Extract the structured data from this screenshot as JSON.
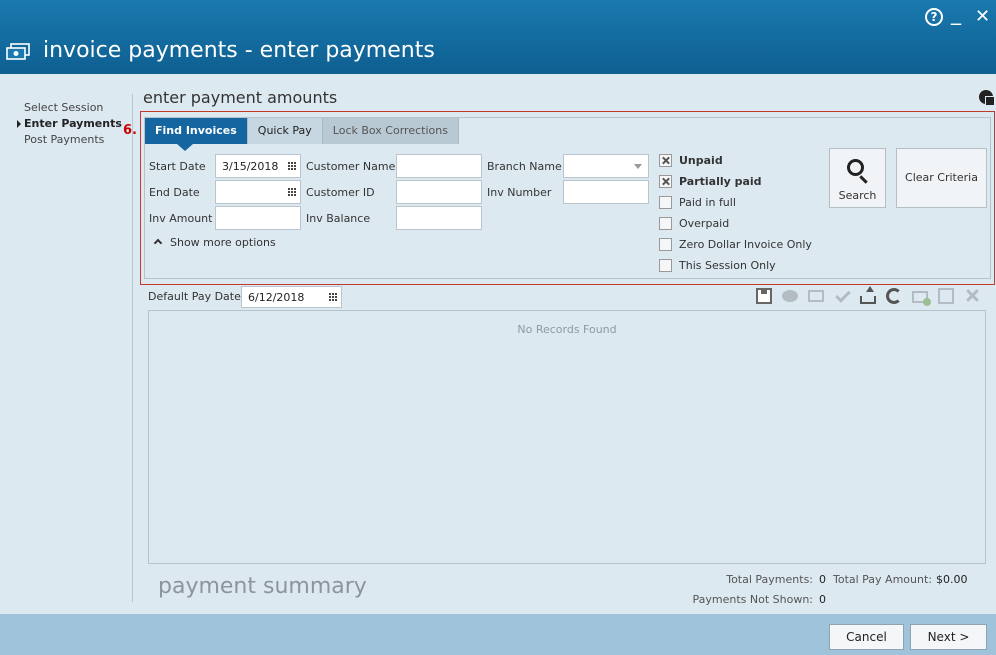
{
  "window": {
    "title": "invoice payments - enter payments",
    "help_label": "?",
    "minimize_label": "_",
    "close_label": "✕"
  },
  "steps": [
    {
      "label": "Select Session"
    },
    {
      "label": "Enter Payments",
      "active": true
    },
    {
      "label": "Post Payments"
    }
  ],
  "section_title": "enter payment amounts",
  "step_marker": "6.",
  "tabs": [
    {
      "label": "Find Invoices",
      "active": true
    },
    {
      "label": "Quick Pay"
    },
    {
      "label": "Lock Box Corrections",
      "disabled": true
    }
  ],
  "fields": {
    "start_date": {
      "label": "Start Date",
      "value": "3/15/2018"
    },
    "end_date": {
      "label": "End Date",
      "value": ""
    },
    "inv_amount": {
      "label": "Inv Amount",
      "value": ""
    },
    "customer_name": {
      "label": "Customer Name",
      "value": ""
    },
    "customer_id": {
      "label": "Customer ID",
      "value": ""
    },
    "inv_balance": {
      "label": "Inv Balance",
      "value": ""
    },
    "branch_name": {
      "label": "Branch Name",
      "value": ""
    },
    "inv_number": {
      "label": "Inv Number",
      "value": ""
    }
  },
  "show_more_label": "Show more options",
  "checkboxes": [
    {
      "label": "Unpaid",
      "checked": true
    },
    {
      "label": "Partially paid",
      "checked": true
    },
    {
      "label": "Paid in full",
      "checked": false
    },
    {
      "label": "Overpaid",
      "checked": false
    },
    {
      "label": "Zero Dollar Invoice Only",
      "checked": false
    },
    {
      "label": "This Session Only",
      "checked": false
    }
  ],
  "buttons": {
    "search": "Search",
    "clear_criteria": "Clear Criteria",
    "cancel": "Cancel",
    "next": "Next >"
  },
  "default_pay_date": {
    "label": "Default Pay Date:",
    "value": "6/12/2018"
  },
  "toolbar_icons": [
    "save-icon",
    "comment-icon",
    "card-icon",
    "check-icon",
    "upload-icon",
    "refresh-icon",
    "add-icon",
    "copy-icon",
    "delete-icon"
  ],
  "grid": {
    "empty_message": "No Records Found"
  },
  "summary": {
    "title": "payment summary",
    "total_payments_label": "Total Payments:",
    "total_payments_value": "0",
    "total_pay_amount_label": "Total Pay Amount:",
    "total_pay_amount_value": "$0.00",
    "payments_not_shown_label": "Payments Not Shown:",
    "payments_not_shown_value": "0"
  },
  "colors": {
    "titlebar": "#1a79ae",
    "active_tab": "#1566a0",
    "find_panel_border": "#c0392b",
    "footer": "#9ec3db"
  }
}
